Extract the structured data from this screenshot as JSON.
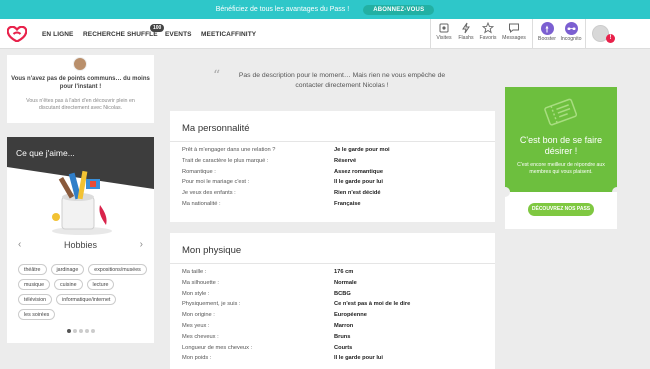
{
  "promo": {
    "text": "Bénéficiez de tous les avantages du Pass !",
    "button": "ABONNEZ-VOUS"
  },
  "nav": {
    "links": [
      "EN LIGNE",
      "RECHERCHE",
      "SHUFFLE",
      "EVENTS",
      "MEETICAFFINITY"
    ],
    "shuffle_badge": "100",
    "icons": [
      "Visites",
      "Flashs",
      "Favoris",
      "Messages",
      "Booster",
      "Incognito"
    ],
    "alert_badge": "!"
  },
  "common": {
    "title": "Vous n'avez pas de points communs… du moins pour l'instant !",
    "subtitle": "Vous n'êtes pas à l'abri d'en découvrir plein en discutant directement avec Nicolas."
  },
  "likes": {
    "title": "Ce que j'aime...",
    "category": "Hobbies",
    "prev": "‹",
    "next": "›",
    "tags": [
      "théâtre",
      "jardinage",
      "expositions/musées",
      "musique",
      "cuisine",
      "lecture",
      "télévision",
      "informatique/internet",
      "les soirées"
    ]
  },
  "quote": {
    "mark": "“",
    "text": "Pas de description pour le moment… Mais rien ne vous empêche de contacter directement Nicolas !"
  },
  "personality": {
    "title": "Ma personnalité",
    "rows": [
      {
        "label": "Prêt à m'engager dans une relation ?",
        "value": "Je le garde pour moi"
      },
      {
        "label": "Trait de caractère le plus marqué :",
        "value": "Réservé"
      },
      {
        "label": "Romantique :",
        "value": "Assez romantique"
      },
      {
        "label": "Pour moi le mariage c'est :",
        "value": "Il le garde pour lui"
      },
      {
        "label": "Je veux des enfants :",
        "value": "Rien n'est décidé"
      },
      {
        "label": "Ma nationalité :",
        "value": "Française"
      }
    ]
  },
  "physique": {
    "title": "Mon physique",
    "rows": [
      {
        "label": "Ma taille :",
        "value": "176 cm"
      },
      {
        "label": "Ma silhouette :",
        "value": "Normale"
      },
      {
        "label": "Mon style :",
        "value": "BCBG"
      },
      {
        "label": "Physiquement, je suis :",
        "value": "Ce n'est pas à moi de le dire"
      },
      {
        "label": "Mon origine :",
        "value": "Européenne"
      },
      {
        "label": "Mes yeux :",
        "value": "Marron"
      },
      {
        "label": "Mes cheveux :",
        "value": "Bruns"
      },
      {
        "label": "Longueur de mes cheveux :",
        "value": "Courts"
      },
      {
        "label": "Mon poids :",
        "value": "Il le garde pour lui"
      }
    ]
  },
  "pass": {
    "title": "C'est bon de se faire désirer !",
    "subtitle": "C'est encore meilleur de répondre aux membres qui vous plaisent.",
    "button": "DÉCOUVREZ NOS PASS"
  },
  "colors": {
    "promo": "#2ec7c9",
    "brand": "#e8214a",
    "pass_green": "#6dbf3e",
    "purple": "#7b5fd1"
  }
}
